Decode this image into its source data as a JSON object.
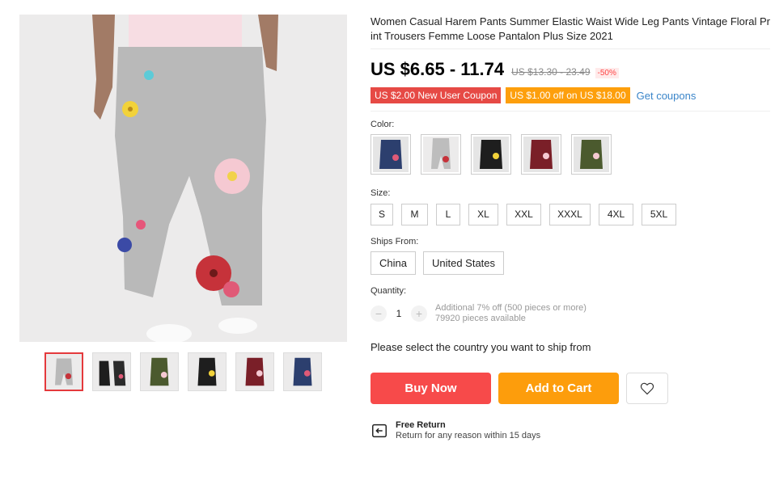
{
  "product": {
    "title": "Women Casual Harem Pants Summer Elastic Waist Wide Leg Pants Vintage Floral Print Trousers Femme Loose Pantalon Plus Size 2021",
    "price": "US $6.65 - 11.74",
    "original_price": "US $13.30 - 23.49",
    "discount": "-50%"
  },
  "coupons": {
    "new_user": "US $2.00 New User Coupon",
    "store": "US $1.00 off on US $18.00",
    "link": "Get coupons"
  },
  "color": {
    "label": "Color:",
    "options": [
      "navy",
      "grey-floral",
      "black",
      "burgundy",
      "army-green"
    ],
    "swatch_colors": [
      "#2c3f6e",
      "#bdbdbd",
      "#1e1e1e",
      "#7a1f28",
      "#4b5a2e"
    ],
    "selected": "grey-floral"
  },
  "size": {
    "label": "Size:",
    "options": [
      "S",
      "M",
      "L",
      "XL",
      "XXL",
      "XXXL",
      "4XL",
      "5XL"
    ]
  },
  "ships_from": {
    "label": "Ships From:",
    "options": [
      "China",
      "United States"
    ]
  },
  "quantity": {
    "label": "Quantity:",
    "minus": "−",
    "value": "1",
    "plus": "+",
    "discount_note": "Additional 7% off (500 pieces or more)",
    "available": "79920 pieces available"
  },
  "ship_message": "Please select the country you want to ship from",
  "actions": {
    "buy_now": "Buy Now",
    "add_to_cart": "Add to Cart",
    "wishlist_icon": "heart-icon"
  },
  "return_policy": {
    "icon": "return-icon",
    "title": "Free Return",
    "subtitle": "Return for any reason within 15 days"
  },
  "theme": {
    "buy_color": "#f74a4a",
    "cart_color": "#fd9d0c",
    "coupon_red": "#e64a45",
    "coupon_orange": "#fd9f0c",
    "link_color": "#3a85c9"
  }
}
